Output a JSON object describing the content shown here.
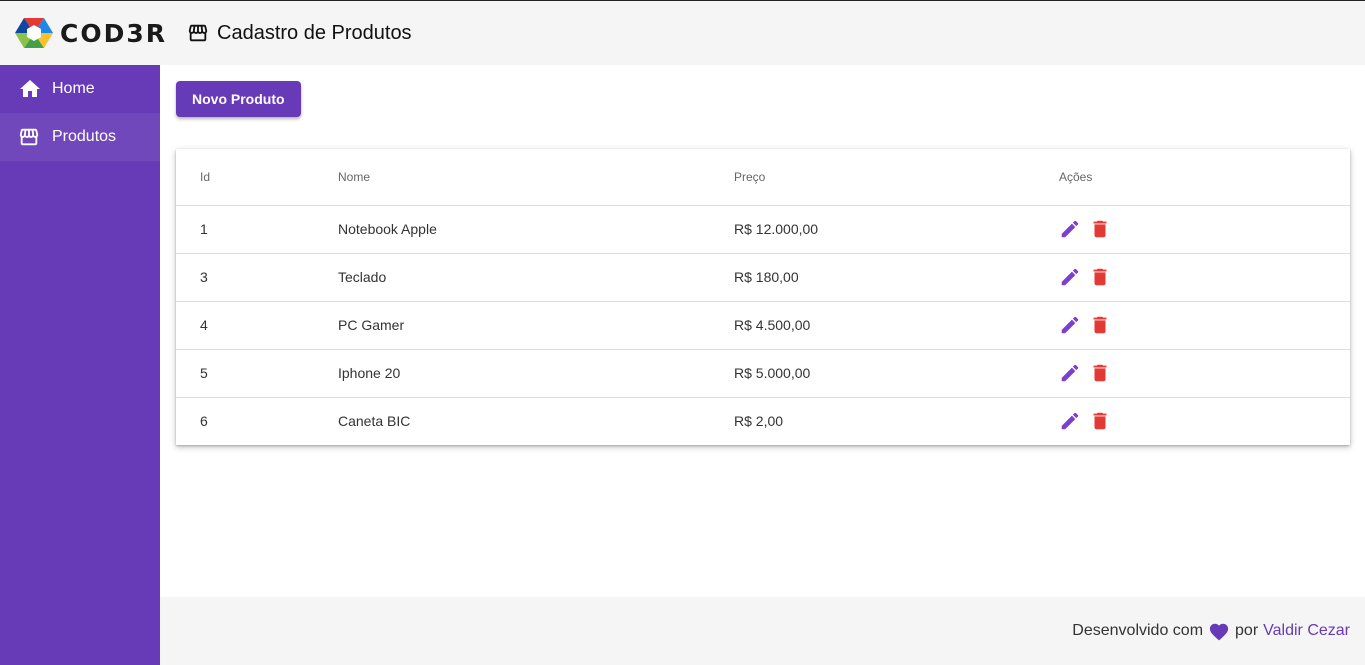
{
  "header": {
    "logo_text": "COD3R",
    "page_title": "Cadastro de Produtos"
  },
  "sidebar": {
    "items": [
      {
        "label": "Home",
        "icon": "home-icon"
      },
      {
        "label": "Produtos",
        "icon": "storefront-icon"
      }
    ]
  },
  "main": {
    "new_button_label": "Novo Produto",
    "table": {
      "headers": [
        "Id",
        "Nome",
        "Preço",
        "Ações"
      ],
      "rows": [
        {
          "id": "1",
          "nome": "Notebook Apple",
          "preco": "R$ 12.000,00"
        },
        {
          "id": "3",
          "nome": "Teclado",
          "preco": "R$ 180,00"
        },
        {
          "id": "4",
          "nome": "PC Gamer",
          "preco": "R$ 4.500,00"
        },
        {
          "id": "5",
          "nome": "Iphone 20",
          "preco": "R$ 5.000,00"
        },
        {
          "id": "6",
          "nome": "Caneta BIC",
          "preco": "R$ 2,00"
        }
      ]
    }
  },
  "footer": {
    "prefix": "Desenvolvido com",
    "middle": "por",
    "author": "Valdir Cezar"
  },
  "colors": {
    "primary": "#673ab7",
    "edit": "#7b3fd1",
    "delete": "#e53935",
    "header_bg": "#f5f5f5"
  }
}
